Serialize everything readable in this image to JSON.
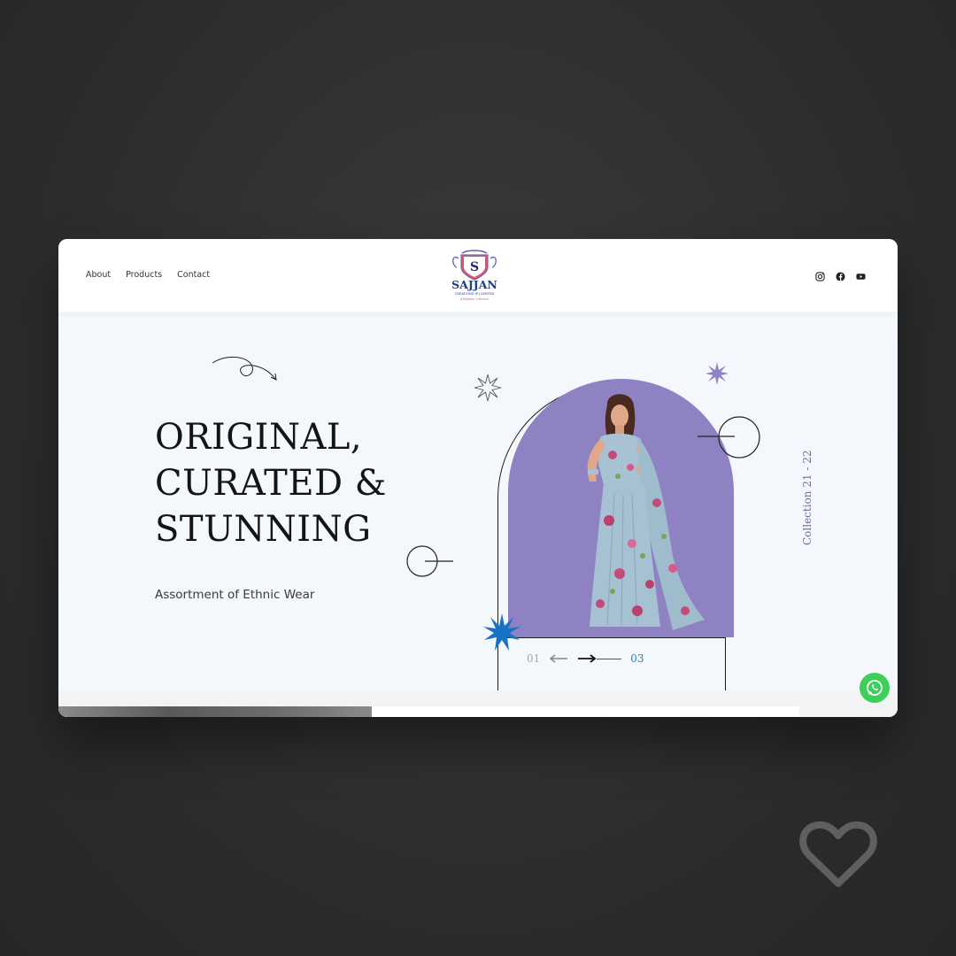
{
  "nav": {
    "items": [
      "About",
      "Products",
      "Contact"
    ]
  },
  "logo": {
    "letter": "S",
    "brand": "SAJJAN",
    "subtitle": "CREATIONS (P) LIMITED",
    "tagline": "A Fashion Universe"
  },
  "socials": [
    {
      "icon": "instagram-icon"
    },
    {
      "icon": "facebook-icon"
    },
    {
      "icon": "youtube-icon"
    }
  ],
  "hero": {
    "headline": [
      "ORIGINAL,",
      "CURATED &",
      "STUNNING"
    ],
    "subline": "Assortment of Ethnic Wear",
    "collection_label": "Collection 21 - 22",
    "slide_current": "01",
    "slide_total": "03"
  },
  "colors": {
    "arch": "#8e82c3",
    "accent_blue": "#1a72c4",
    "accent_purple": "#8e82c3",
    "whatsapp": "#3ecf5b"
  }
}
